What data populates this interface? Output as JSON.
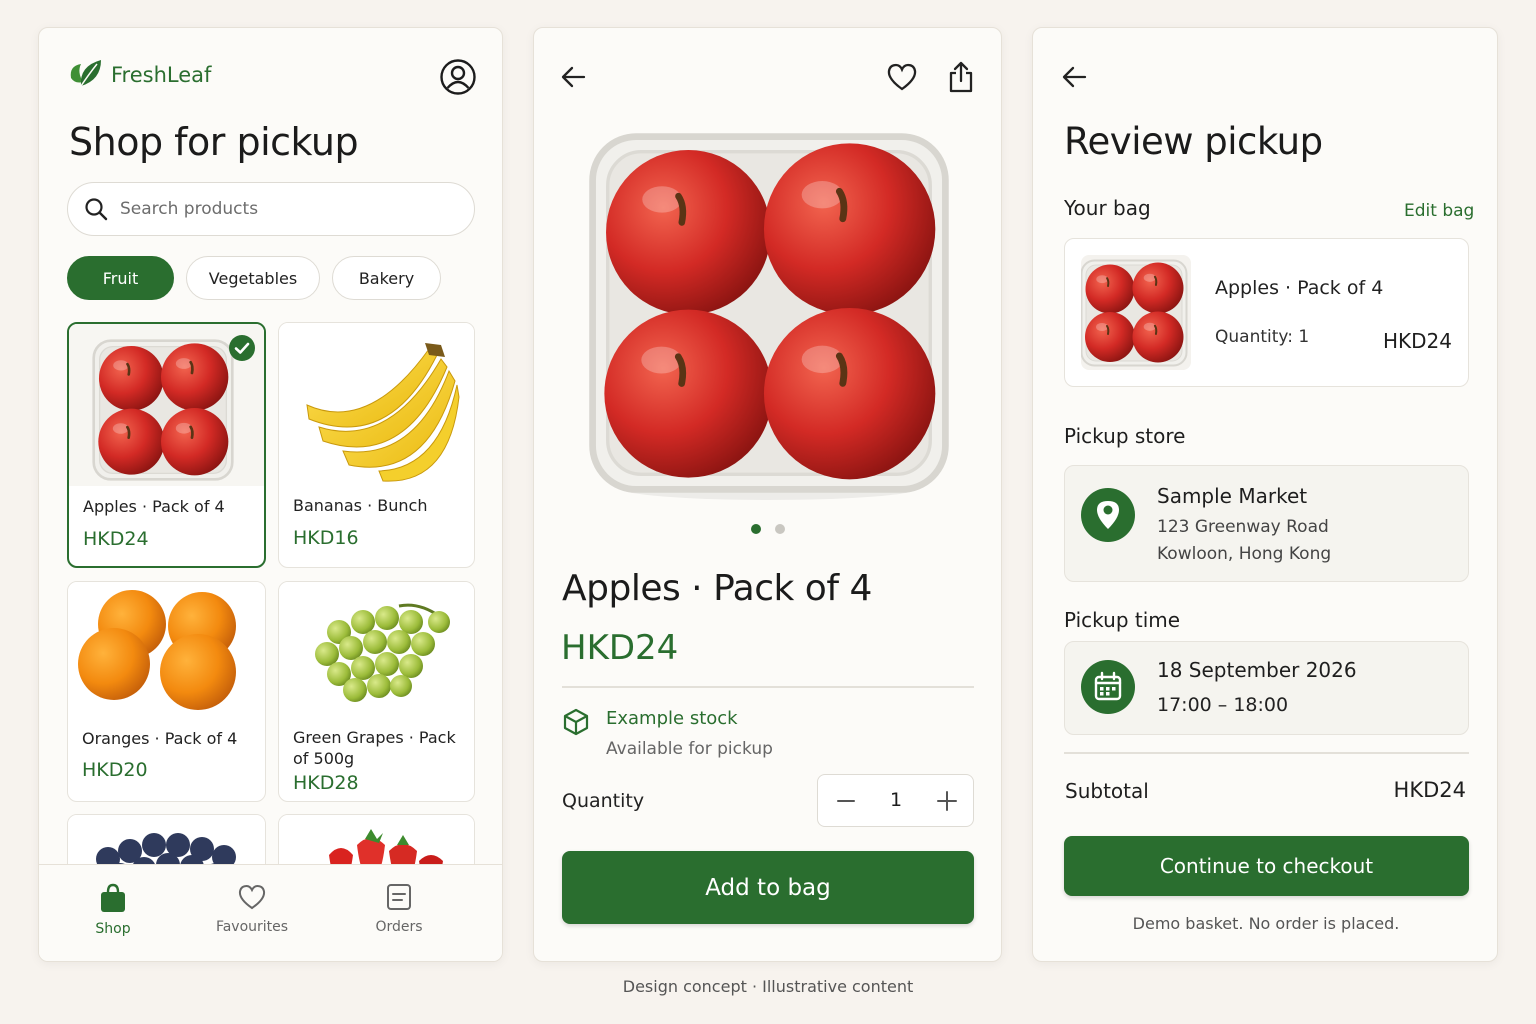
{
  "shop": {
    "brand": "FreshLeaf",
    "title": "Shop for pickup",
    "search_placeholder": "Search products",
    "chips": [
      "Fruit",
      "Vegetables",
      "Bakery"
    ],
    "products": [
      {
        "name": "Apples · Pack of 4",
        "price": "HKD24",
        "selected": true
      },
      {
        "name": "Bananas · Bunch",
        "price": "HKD16"
      },
      {
        "name": "Oranges · Pack of 4",
        "price": "HKD20"
      },
      {
        "name": "Green Grapes · Pack of 500g",
        "price": "HKD28"
      }
    ],
    "nav": [
      "Shop",
      "Favourites",
      "Orders"
    ]
  },
  "detail": {
    "title": "Apples · Pack of 4",
    "price": "HKD24",
    "stock_title": "Example stock",
    "stock_sub": "Available for pickup",
    "quantity_label": "Quantity",
    "quantity": "1",
    "add_button": "Add to bag"
  },
  "review": {
    "title": "Review pickup",
    "bag_label": "Your bag",
    "edit_link": "Edit bag",
    "item_name": "Apples · Pack of 4",
    "item_qty": "Quantity: 1",
    "item_price": "HKD24",
    "store_label": "Pickup store",
    "store_name": "Sample Market",
    "store_addr1": "123 Greenway Road",
    "store_addr2": "Kowloon, Hong Kong",
    "time_label": "Pickup time",
    "date": "18 September 2026",
    "time": "17:00 – 18:00",
    "subtotal_label": "Subtotal",
    "subtotal": "HKD24",
    "checkout_button": "Continue to checkout",
    "note": "Demo basket. No order is placed."
  },
  "footer": "Design concept · Illustrative content",
  "colors": {
    "accent": "#2a6e2f",
    "background": "#f7f3ee"
  },
  "icons": [
    "leaf-logo-icon",
    "profile-icon",
    "search-icon",
    "check-icon",
    "shopping-bag-icon",
    "heart-icon",
    "orders-icon",
    "back-arrow-icon",
    "share-icon",
    "box-icon",
    "minus-icon",
    "plus-icon",
    "location-pin-icon",
    "calendar-icon"
  ]
}
